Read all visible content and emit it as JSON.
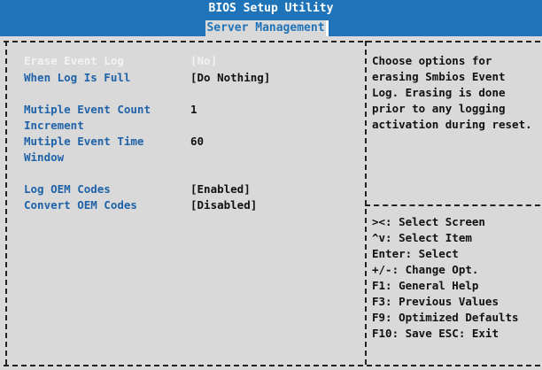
{
  "app_title": "BIOS Setup Utility",
  "active_tab": "Server Management",
  "settings": [
    {
      "label": "Erase Event Log",
      "value": "[No]",
      "enabled": false
    },
    {
      "label": "When Log Is Full",
      "value": "[Do Nothing]",
      "enabled": true
    },
    {
      "label": "Mutiple Event Count",
      "label2": "Increment",
      "value": "1",
      "enabled": true
    },
    {
      "label": "Mutiple Event Time",
      "label2": "Window",
      "value": "60",
      "enabled": true
    },
    {
      "label": "Log OEM Codes",
      "value": "[Enabled]",
      "enabled": true
    },
    {
      "label": "Convert OEM Codes",
      "value": "[Disabled]",
      "enabled": true
    }
  ],
  "help_text": [
    "Choose options for",
    "erasing Smbios Event",
    "Log.  Erasing is done",
    "prior to any logging",
    "activation during reset."
  ],
  "key_help": [
    "><: Select Screen",
    "^v: Select Item",
    "Enter: Select",
    "+/-: Change Opt.",
    "F1: General Help",
    "F3: Previous Values",
    "F9: Optimized Defaults",
    "F10: Save  ESC: Exit"
  ],
  "colors": {
    "title_bar": "#1f73b8",
    "background": "#d9d9d9",
    "label": "#1f62a8",
    "highlight": "#f2f2f2"
  }
}
